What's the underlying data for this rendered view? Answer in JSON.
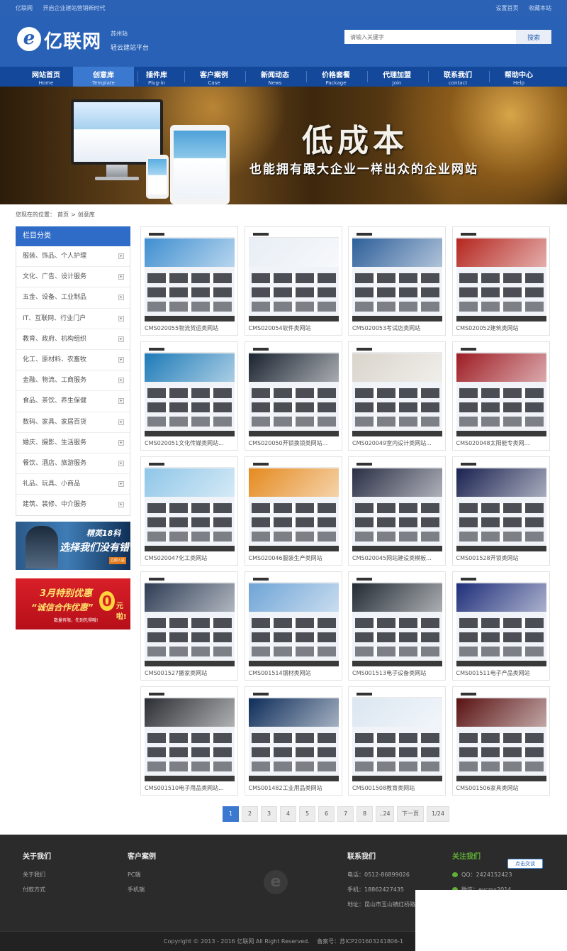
{
  "topbar": {
    "left": [
      "亿联网",
      "开启企业建站营销新时代"
    ],
    "right": [
      "设置首页",
      "收藏本站"
    ]
  },
  "header": {
    "logo_mark": "e",
    "logo_text": "亿联网",
    "city": "苏州站",
    "slogan": "轻云建站平台",
    "search_placeholder": "请输入关键字",
    "search_button": "搜索"
  },
  "nav": [
    {
      "cn": "网站首页",
      "en": "Home"
    },
    {
      "cn": "创意库",
      "en": "Template"
    },
    {
      "cn": "插件库",
      "en": "Plug-in"
    },
    {
      "cn": "客户案例",
      "en": "Case"
    },
    {
      "cn": "新闻动态",
      "en": "News"
    },
    {
      "cn": "价格套餐",
      "en": "Package"
    },
    {
      "cn": "代理加盟",
      "en": "Join"
    },
    {
      "cn": "联系我们",
      "en": "contact"
    },
    {
      "cn": "帮助中心",
      "en": "Help"
    }
  ],
  "banner": {
    "title": "低成本",
    "subtitle": "也能拥有跟大企业一样出众的企业网站"
  },
  "breadcrumb": [
    "您现在的位置：",
    "首页",
    ">",
    "创意库"
  ],
  "sidebar": {
    "heading": "栏目分类",
    "items": [
      "服装、饰品、个人护理",
      "文化、广告、设计服务",
      "五金、设备、工业制品",
      "IT、互联网、行业门户",
      "教育、政府、机构组织",
      "化工、原材料、农畜牧",
      "金融、物流、工商服务",
      "食品、茶饮、养生保健",
      "数码、家具、家居百货",
      "婚庆、摄影、生活服务",
      "餐饮、酒店、旅游服务",
      "礼品、玩具、小商品",
      "建筑、装修、中介服务"
    ],
    "ad1": {
      "t1": "精英18科",
      "t2": "选择我们没有错",
      "btn": "立即入驻"
    },
    "ad2": {
      "t1": "3月特别优惠",
      "t2": "“诚信合作优惠”",
      "zero": "0",
      "yuan": "元啦!",
      "t3": "数量有限，先到先得哦!"
    }
  },
  "templates": [
    "CMS020055物流货运类网站",
    "CMS020054软件类网站",
    "CMS020053考试店类网站",
    "CMS020052建筑类网站",
    "CMS020051文化传媒类网站...",
    "CMS020050开锁换锁类网站...",
    "CMS020049室内设计类网站...",
    "CMS020048太阳能专类网...",
    "CMS020047化工类网站",
    "CMS020046服装生产类网站",
    "CMS020045网站建设类模板...",
    "CMS001528开锁类网站",
    "CMS001527搬家类网站",
    "CMS001514钢材类网站",
    "CMS001513电子设备类网站",
    "CMS001511电子产品类网站",
    "CMS001510电子用品类网站...",
    "CMS001482工业用品类网站",
    "CMS001508教育类网站",
    "CMS001506家具类网站"
  ],
  "thumb_colors": [
    "#3f8fd0",
    "#e8eef5",
    "#2d5f9a",
    "#b5261f",
    "#1e7bb8",
    "#1a2330",
    "#d9d4cb",
    "#9e1c24",
    "#8fc6e8",
    "#e58a1f",
    "#2a2f45",
    "#1a2250",
    "#2e3d55",
    "#6fa4d6",
    "#222a33",
    "#1f2f7a",
    "#2b2e33",
    "#0e2d5a",
    "#dbe6f1",
    "#5a1212"
  ],
  "pager": [
    "1",
    "2",
    "3",
    "4",
    "5",
    "6",
    "7",
    "8",
    "..24",
    "下一页",
    "1/24"
  ],
  "footer": {
    "about": {
      "title": "关于我们",
      "links": [
        "关于我们",
        "付款方式"
      ]
    },
    "cases": {
      "title": "客户案例",
      "links": [
        "PC端",
        "手机端"
      ]
    },
    "contact": {
      "title": "联系我们",
      "lines": [
        "电话：0512-86899026",
        "手机：18862427435",
        "地址：昆山市玉山镇红桥路3"
      ]
    },
    "follow": {
      "title": "关注我们",
      "qq": "QQ：2424152423",
      "wechat": "微信：eycms2014"
    },
    "chat": "点击交谈",
    "copyright": "Copyright © 2013 - 2016 亿联网 All Right Reserved.",
    "icp": "备案号：苏ICP201603241806-1"
  }
}
